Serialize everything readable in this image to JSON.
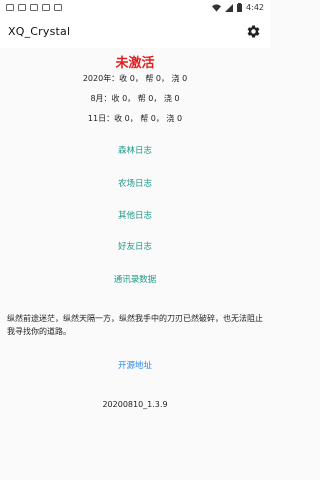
{
  "statusBar": {
    "time": "4:42",
    "icons": [
      "notification-icon",
      "notification-icon",
      "notification-icon",
      "notification-icon",
      "notification-icon"
    ]
  },
  "appBar": {
    "title": "XQ_Crystal",
    "settingsIcon": "gear-icon"
  },
  "main": {
    "activationStatus": "未激活",
    "stats": {
      "year": "2020年：收 0，  帮 0，  浇 0",
      "month": "8月：收 0，  帮 0，  浇 0",
      "day": "11日：收 0，  帮 0，  浇 0"
    },
    "links": {
      "forestLog": "森林日志",
      "farmLog": "农场日志",
      "otherLog": "其他日志",
      "friendLog": "好友日志",
      "contactsData": "通讯录数据"
    },
    "poem": "纵然前途迷茫，纵然天隔一方，纵然我手中的刀刃已然破碎，也无法阻止我寻找你的道路。",
    "sourceLink": "开源地址",
    "version": "20200810_1.3.9"
  },
  "colors": {
    "inactiveRed": "#e02020",
    "linkTeal": "#1e9988",
    "linkBlue": "#2e8ae6"
  }
}
